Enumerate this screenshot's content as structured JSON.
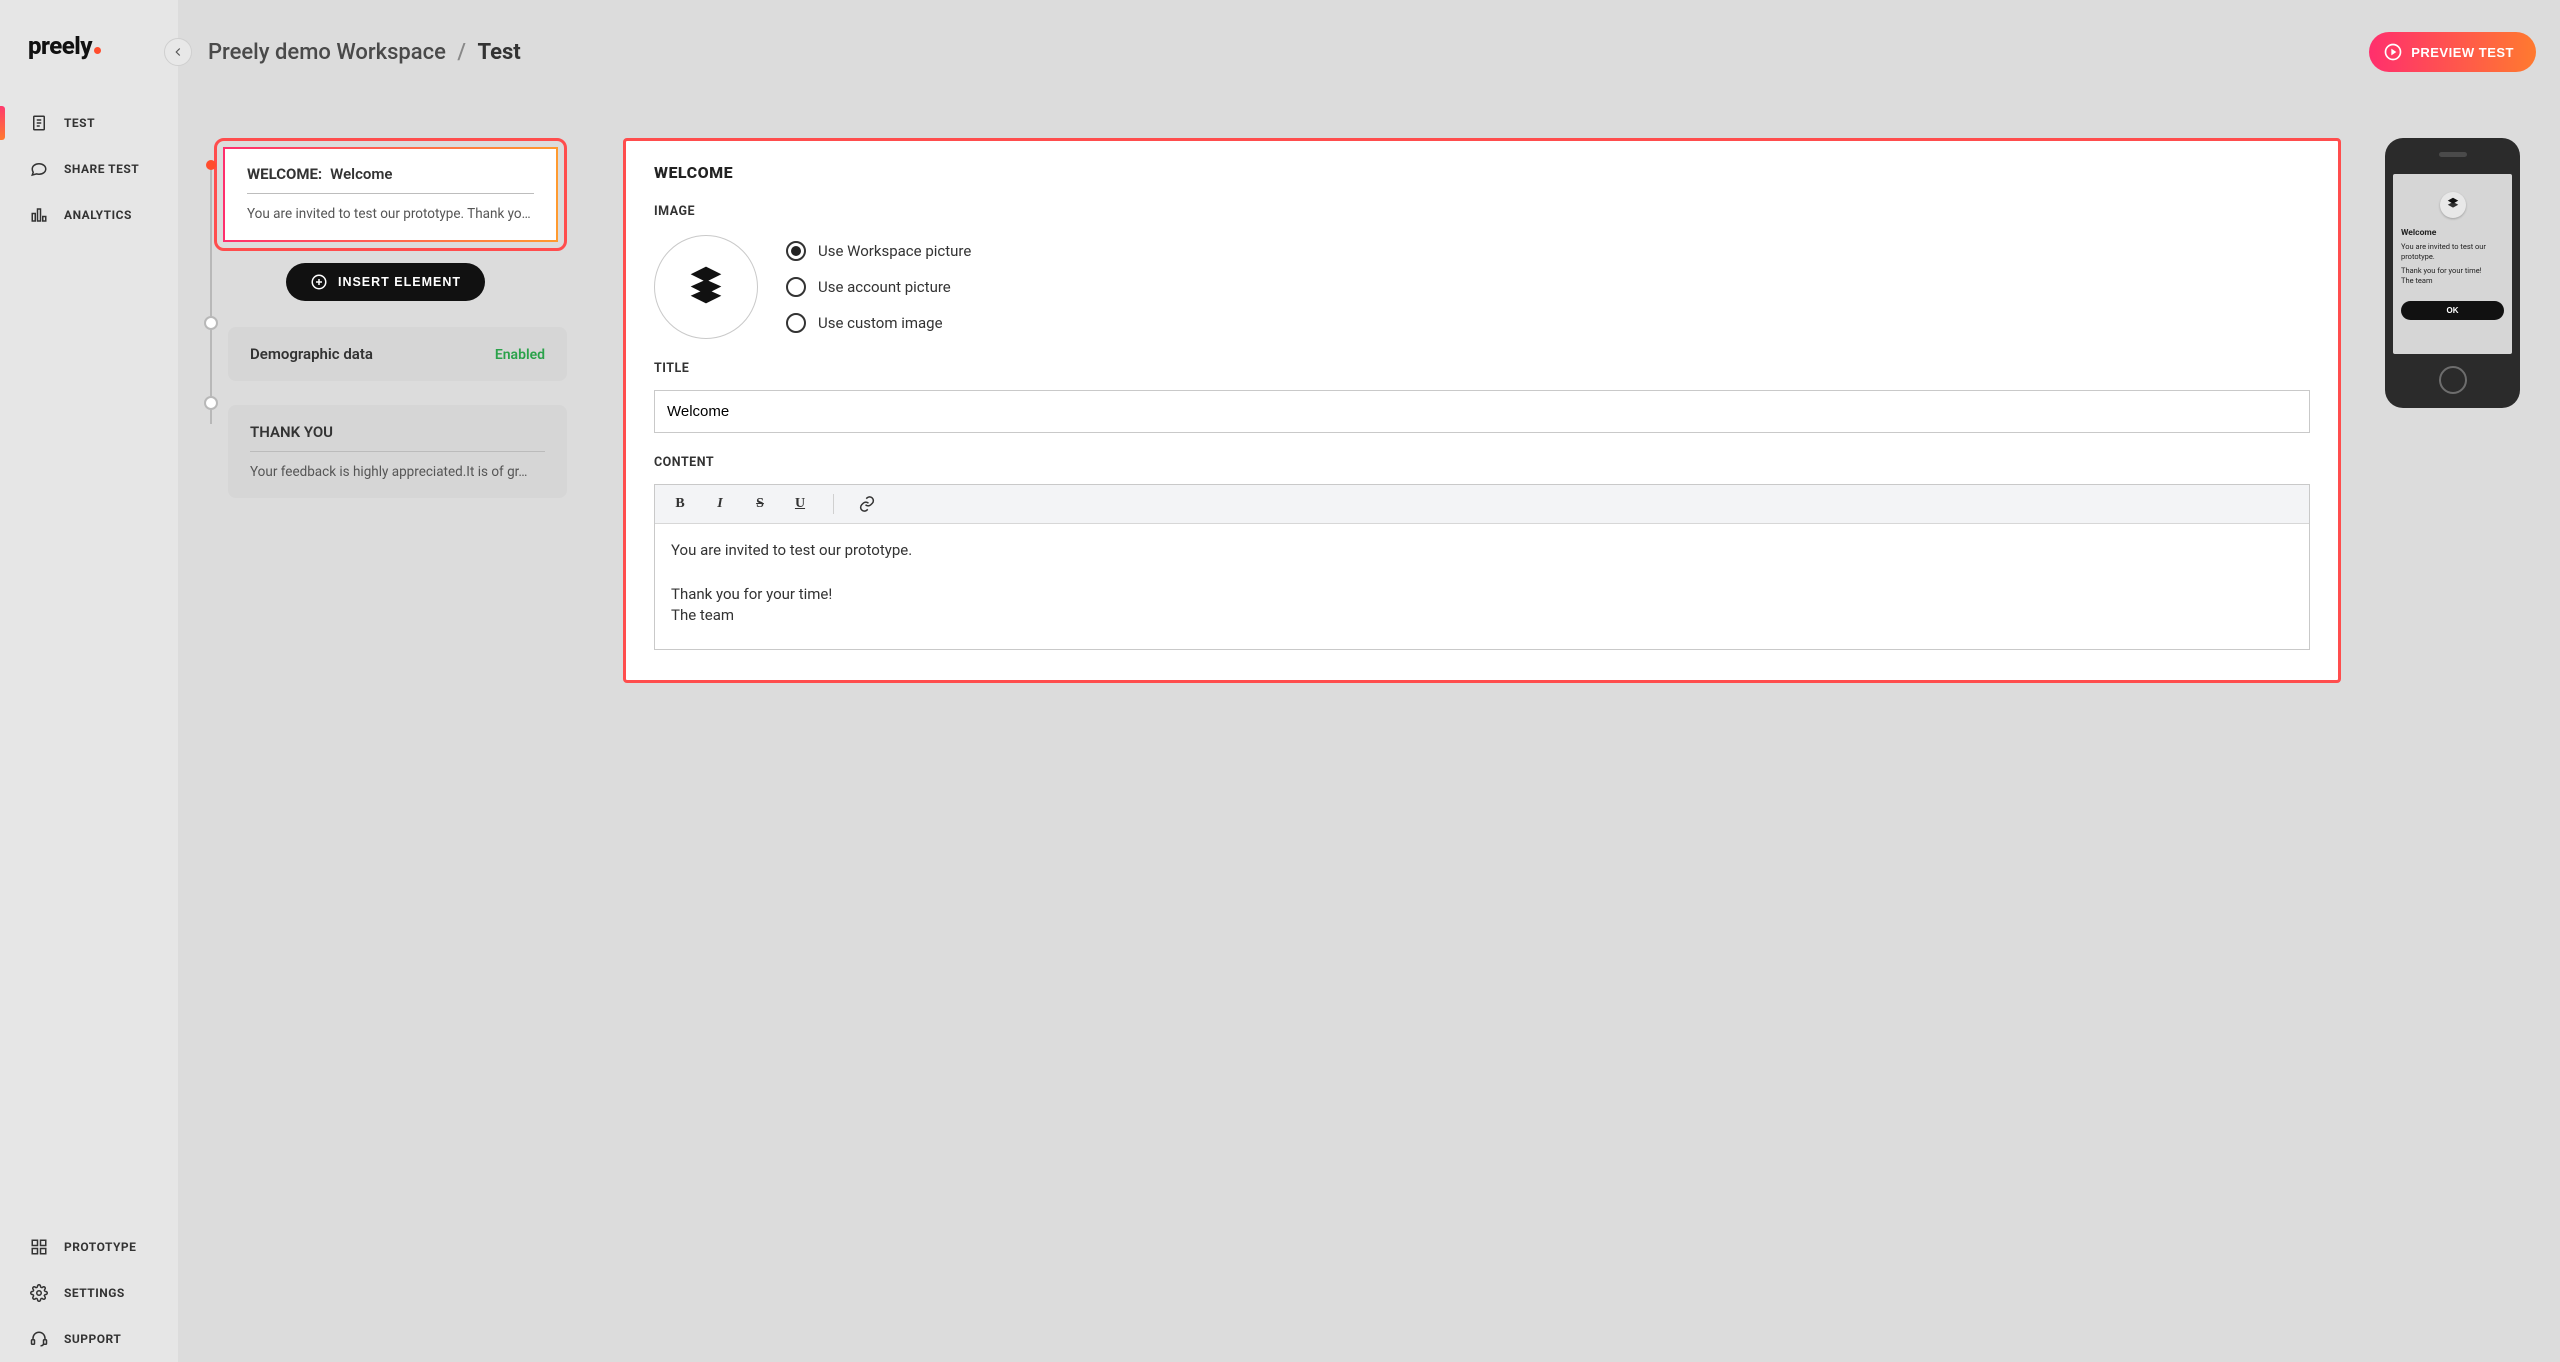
{
  "brand": "preely",
  "sidebar": {
    "top": [
      {
        "label": "TEST",
        "icon": "doc"
      },
      {
        "label": "SHARE TEST",
        "icon": "chat"
      },
      {
        "label": "ANALYTICS",
        "icon": "analytics"
      }
    ],
    "bottom": [
      {
        "label": "PROTOTYPE",
        "icon": "grid"
      },
      {
        "label": "SETTINGS",
        "icon": "gear"
      },
      {
        "label": "SUPPORT",
        "icon": "headset"
      }
    ]
  },
  "breadcrumb": {
    "workspace": "Preely demo Workspace",
    "sep": "/",
    "current": "Test"
  },
  "previewButton": "PREVIEW TEST",
  "insertButton": "INSERT ELEMENT",
  "steps": {
    "welcome": {
      "label": "WELCOME:",
      "title": "Welcome",
      "desc": "You are invited to test our prototype. Thank yo…"
    },
    "demographic": {
      "title": "Demographic data",
      "status": "Enabled"
    },
    "thankyou": {
      "label": "THANK YOU",
      "desc": "Your feedback is highly appreciated.It is of gr…"
    }
  },
  "detail": {
    "heading": "WELCOME",
    "imageLabel": "IMAGE",
    "imageOptions": {
      "workspace": "Use Workspace picture",
      "account": "Use account picture",
      "custom": "Use custom image",
      "selected": "workspace"
    },
    "titleLabel": "TITLE",
    "titleValue": "Welcome",
    "contentLabel": "CONTENT",
    "contentBody": "You are invited to test our prototype.\n\nThank you for your time!\nThe team"
  },
  "phonePreview": {
    "title": "Welcome",
    "line1": "You are invited to test our prototype.",
    "line2": "Thank you for your time!\nThe team",
    "ok": "OK"
  }
}
